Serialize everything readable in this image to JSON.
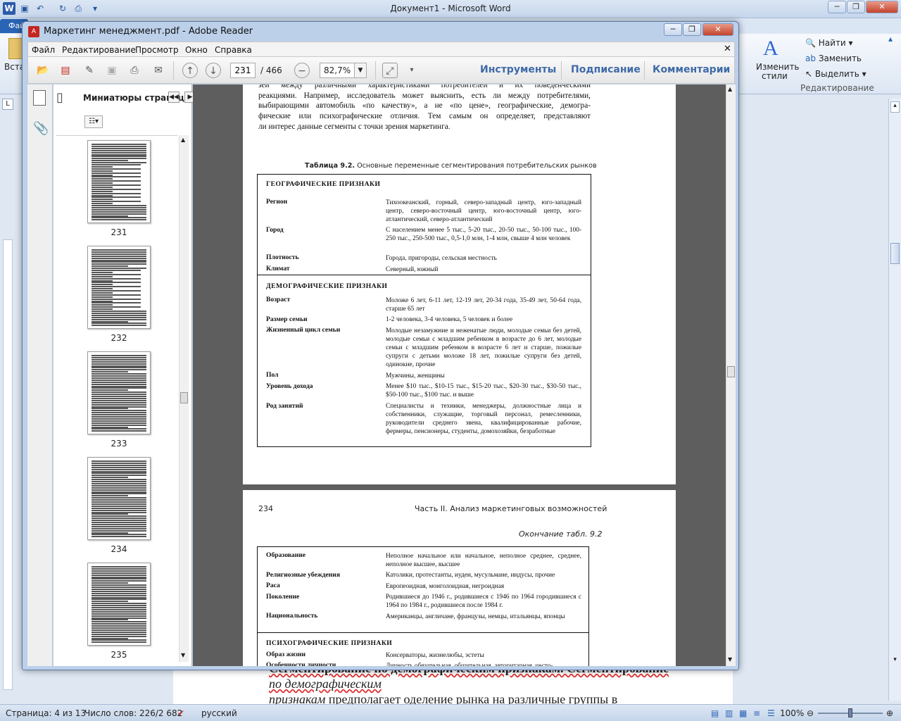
{
  "word": {
    "title": "Документ1 - Microsoft Word",
    "file_tab": "Фай",
    "ribbon": {
      "paste_partial": "Вста",
      "find": "Найти",
      "replace": "Заменить",
      "select": "Выделить",
      "change_styles_1": "Изменить",
      "change_styles_2": "стили",
      "editing_group": "Редактирование"
    },
    "doc_line1": "Сегментирование по демографическим признакам. Сегментирование",
    "doc_line2": "по демографическим",
    "doc_line3_em": "признакам",
    "doc_line3_rest": " предполагает  оделение рынка на различные группы в",
    "status": {
      "page": "Страница: 4 из 13",
      "words": "Число слов: 226/2 682",
      "language": "русский",
      "zoom": "100%"
    }
  },
  "reader": {
    "title": "Маркетинг менеджмент.pdf - Adobe Reader",
    "menu": [
      "Файл",
      "Редактирование",
      "Просмотр",
      "Окно",
      "Справка"
    ],
    "page_current": "231",
    "page_total": "/ 466",
    "zoom": "82,7%",
    "right_tools": [
      "Инструменты",
      "Подписание",
      "Комментарии"
    ],
    "thumbs_title": "Миниатюры страниц",
    "thumb_pages": [
      "231",
      "232",
      "233",
      "234",
      "235"
    ]
  },
  "page1": {
    "intro_lines": [
      "зей между различными характеристиками потребителей и их поведенческими",
      "реакциями. Например, исследователь может выяснить, есть ли между потребителями,",
      "выбирающими автомобиль «по качеству», а не «по цене», географические, демогра-",
      "фические или психографические отличия. Тем самым он определяет, представляют",
      "ли интерес данные сегменты с точки зрения маркетинга."
    ],
    "table_caption_bold": "Таблица 9.2.",
    "table_caption": " Основные переменные сегментирования потребительских рынков",
    "geo_head": "ГЕОГРАФИЧЕСКИЕ    ПРИЗНАКИ",
    "geo_rows": [
      {
        "label": "Регион",
        "value": "Тихоокеанский, горный, северо-западный центр, юго-западный центр, северо-восточный центр, юго-восточный центр, юго-атлантический, северо-атлантический"
      },
      {
        "label": "Город",
        "value": "С населением менее 5 тыс., 5-20 тыс., 20-50 тыс., 50-100 тыс., 100-250 тыс., 250-500 тыс., 0,5-1,0 млн, 1-4 млн, свыше 4 млн человек"
      },
      {
        "label": "Плотность",
        "value": "Города, пригороды, сельская местность"
      },
      {
        "label": "Климат",
        "value": "Северный, южный"
      }
    ],
    "demo_head": "ДЕМОГРАФИЧЕСКИЕ    ПРИЗНАКИ",
    "demo_rows": [
      {
        "label": "Возраст",
        "value": "Моложе 6 лет, 6-11 лет, 12-19 лет, 20-34 года, 35-49 лет, 50-64 года, старше 65 лет"
      },
      {
        "label": "Размер семьи",
        "value": "1-2 человека, 3-4 человека, 5 человек и более"
      },
      {
        "label": "Жизненный цикл семьи",
        "value": "Молодые незамужние и неженатые люди, молодые семьи без детей, молодые семьи с младшим ребенком в возрасте до 6 лет, молодые семьи с младшим ребенком в возрасте 6 лет и старше, пожилые супруги с детьми моложе 18 лет, пожилые супруги без детей, одинокие, прочие"
      },
      {
        "label": "Пол",
        "value": "Мужчины, женщины"
      },
      {
        "label": "Уровень дохода",
        "value": "Менее $10 тыс.,  $10-15 тыс.,  $15-20 тыс., $20-30 тыс., $30-50 тыс., $50-100 тыс., $100 тыс. и выше"
      },
      {
        "label": "Род занятий",
        "value": "Специалисты и техники, менеджеры, должностные лица и собственники, служащие, торговый персонал, ремесленники, руководители среднего звена, квалифицированные рабочие, фермеры, пенсионеры, студенты, домохозяйки, безработные"
      }
    ]
  },
  "page2": {
    "page_number": "234",
    "running_head": "Часть II. Анализ маркетинговых возможностей",
    "continued": "Окончание табл. 9.2",
    "rows": [
      {
        "label": "Образование",
        "value": "Неполное начальное или начальное, неполное среднее, среднее, неполное высшее, высшее"
      },
      {
        "label": "Религиозные убеждения",
        "value": "Католики, протестанты, иудеи, мусульмане, индусы, прочие"
      },
      {
        "label": "Раса",
        "value": "Европеоидная, монголоидная, негроидная"
      },
      {
        "label": "Поколение",
        "value": "Родившиеся до 1946 г., родившиеся с 1946 по 1964 городившиеся с 1964 по 1984 г., родившиеся после 1984 г."
      },
      {
        "label": "Национальность",
        "value": "Американцы, англичане, французы, немцы, итальянцы, японцы"
      }
    ],
    "psy_head": "ПСИХОГРАФИЧЕСКИЕ  ПРИЗНАКИ",
    "psy_rows": [
      {
        "label": "Образ жизни",
        "value": "Консерваторы, жизнелюбы, эстеты"
      },
      {
        "label": "Особенности личности",
        "value": "Личность обязательная, общительная, авторитарная, често-"
      }
    ]
  }
}
